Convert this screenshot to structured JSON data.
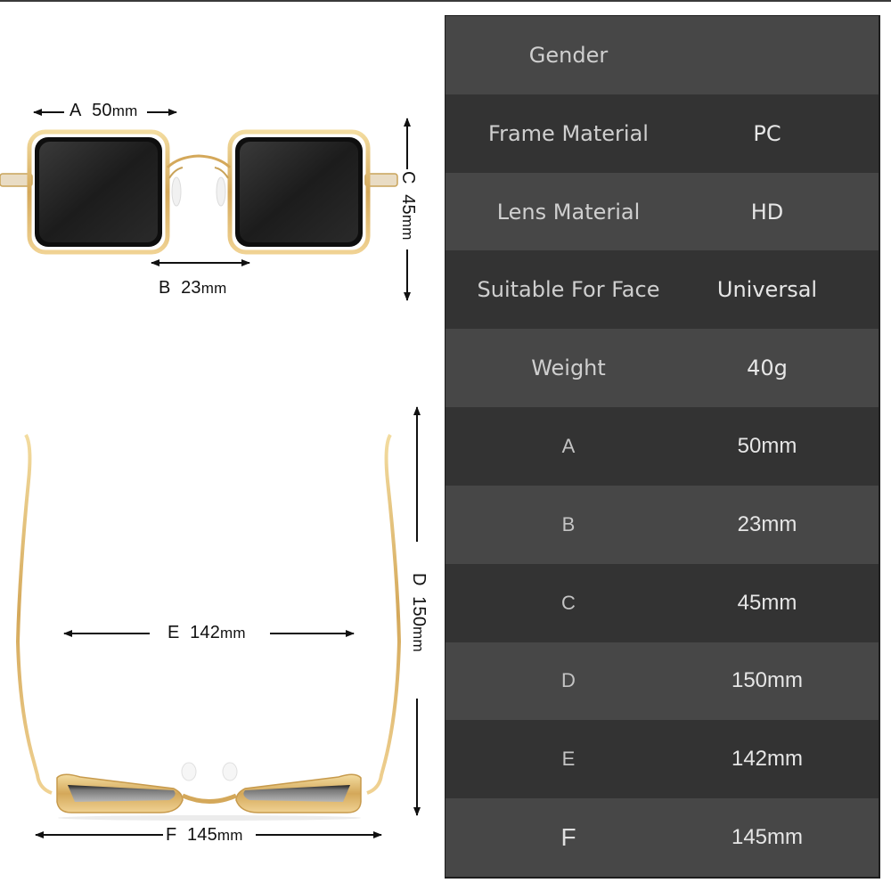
{
  "illustration": {
    "front_view": {
      "A": {
        "letter": "A",
        "value": "50",
        "unit": "mm"
      },
      "B": {
        "letter": "B",
        "value": "23",
        "unit": "mm"
      },
      "C": {
        "letter": "C",
        "value": "45",
        "unit": "mm"
      }
    },
    "top_view": {
      "D": {
        "letter": "D",
        "value": "150",
        "unit": "mm"
      },
      "E": {
        "letter": "E",
        "value": "142",
        "unit": "mm"
      },
      "F": {
        "letter": "F",
        "value": "145",
        "unit": "mm"
      }
    },
    "colors": {
      "frame_gold": "#d9b56a",
      "lens_dark": "#1a1a1a",
      "arrow": "#111111"
    }
  },
  "spec_table": {
    "colors": {
      "row_light": "#474747",
      "row_dark": "#333333",
      "text": "#cfcfcf"
    },
    "rows": [
      {
        "label": "Gender",
        "value": ""
      },
      {
        "label": "Frame Material",
        "value": "PC"
      },
      {
        "label": "Lens Material",
        "value": "HD"
      },
      {
        "label": "Suitable For Face",
        "value": "Universal"
      },
      {
        "label": "Weight",
        "value": "40g"
      },
      {
        "label": "A",
        "value": "50mm"
      },
      {
        "label": "B",
        "value": "23mm"
      },
      {
        "label": "C",
        "value": "45mm"
      },
      {
        "label": "D",
        "value": "150mm"
      },
      {
        "label": "E",
        "value": "142mm"
      },
      {
        "label": "F",
        "value": "145mm"
      }
    ]
  }
}
